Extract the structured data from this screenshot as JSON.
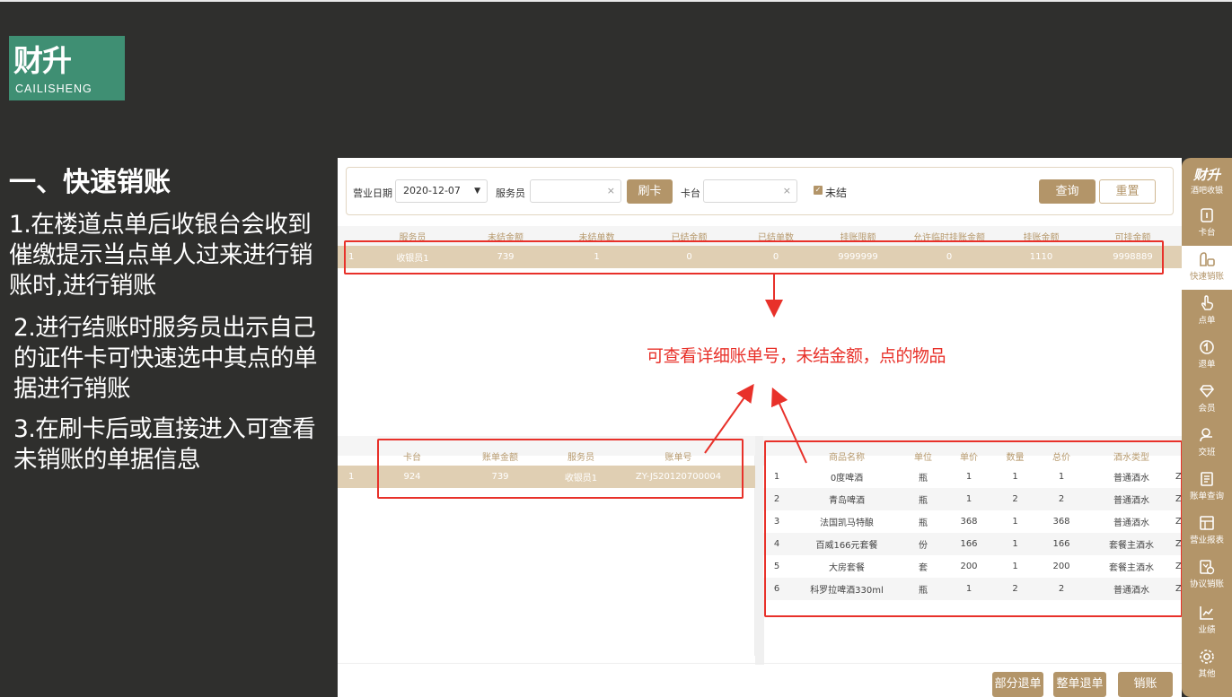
{
  "logo": {
    "main": "财升",
    "sub": "CAILISHENG"
  },
  "left": {
    "title": "一、快速销账",
    "step1": "1.在楼道点单后收银台会收到催缴提示当点单人过来进行销账时,进行销账",
    "step2": "2.进行结账时服务员出示自己的证件卡可快速选中其点的单据进行销账",
    "step3": "3.在刷卡后或直接进入可查看未销账的单据信息"
  },
  "filter": {
    "date_label": "营业日期",
    "date_value": "2020-12-07",
    "waiter_label": "服务员",
    "swipe_button": "刷卡",
    "table_label": "卡台",
    "unsettled_label": "未结",
    "query_button": "查询",
    "reset_button": "重置",
    "clear_symbol": "×",
    "check_symbol": "✓"
  },
  "summary": {
    "headers": [
      "服务员",
      "未结金额",
      "未结单数",
      "已结金额",
      "已结单数",
      "挂账限额",
      "允许临时挂账金额",
      "挂账金额",
      "可挂金额"
    ],
    "rows": [
      {
        "idx": "1",
        "cells": [
          "收银员1",
          "739",
          "1",
          "0",
          "0",
          "9999999",
          "0",
          "1110",
          "9998889"
        ]
      }
    ]
  },
  "bills": {
    "headers": [
      "卡台",
      "账单金额",
      "服务员",
      "账单号"
    ],
    "rows": [
      {
        "idx": "1",
        "cells": [
          "924",
          "739",
          "收银员1",
          "ZY-JS20120700004"
        ]
      }
    ]
  },
  "items": {
    "headers": [
      "商品名称",
      "单位",
      "单价",
      "数量",
      "总价",
      "酒水类型"
    ],
    "rows": [
      {
        "idx": "1",
        "cells": [
          "0度啤酒",
          "瓶",
          "1",
          "1",
          "1",
          "普通酒水",
          "ZY"
        ]
      },
      {
        "idx": "2",
        "cells": [
          "青岛啤酒",
          "瓶",
          "1",
          "2",
          "2",
          "普通酒水",
          "ZY"
        ]
      },
      {
        "idx": "3",
        "cells": [
          "法国凯马特酿",
          "瓶",
          "368",
          "1",
          "368",
          "普通酒水",
          "ZY"
        ]
      },
      {
        "idx": "4",
        "cells": [
          "百威166元套餐",
          "份",
          "166",
          "1",
          "166",
          "套餐主酒水",
          "ZY"
        ]
      },
      {
        "idx": "5",
        "cells": [
          "大房套餐",
          "套",
          "200",
          "1",
          "200",
          "套餐主酒水",
          "ZY"
        ]
      },
      {
        "idx": "6",
        "cells": [
          "科罗拉啤酒330ml",
          "瓶",
          "1",
          "2",
          "2",
          "普通酒水",
          "ZY"
        ]
      }
    ]
  },
  "actions": {
    "partial_refund": "部分退单",
    "full_refund": "整单退单",
    "settle": "销账"
  },
  "annotation": "可查看详细账单号，未结金额，点的物品",
  "sidebar": {
    "brand": "财升",
    "brand_sub": "酒吧收银",
    "items": [
      {
        "label": "卡台",
        "icon": "card-icon"
      },
      {
        "label": "快速销账",
        "icon": "quick-settle-icon"
      },
      {
        "label": "点单",
        "icon": "order-icon"
      },
      {
        "label": "退单",
        "icon": "refund-icon"
      },
      {
        "label": "会员",
        "icon": "member-icon"
      },
      {
        "label": "交班",
        "icon": "shift-icon"
      },
      {
        "label": "账单查询",
        "icon": "bill-query-icon"
      },
      {
        "label": "营业报表",
        "icon": "report-icon"
      },
      {
        "label": "协议销账",
        "icon": "agreement-icon"
      },
      {
        "label": "业绩",
        "icon": "performance-icon"
      },
      {
        "label": "其他",
        "icon": "settings-icon"
      }
    ]
  },
  "colors": {
    "accent": "#b39569",
    "annotation": "#e8312a",
    "background": "#2f2f2d",
    "logo": "#3f8f73"
  }
}
